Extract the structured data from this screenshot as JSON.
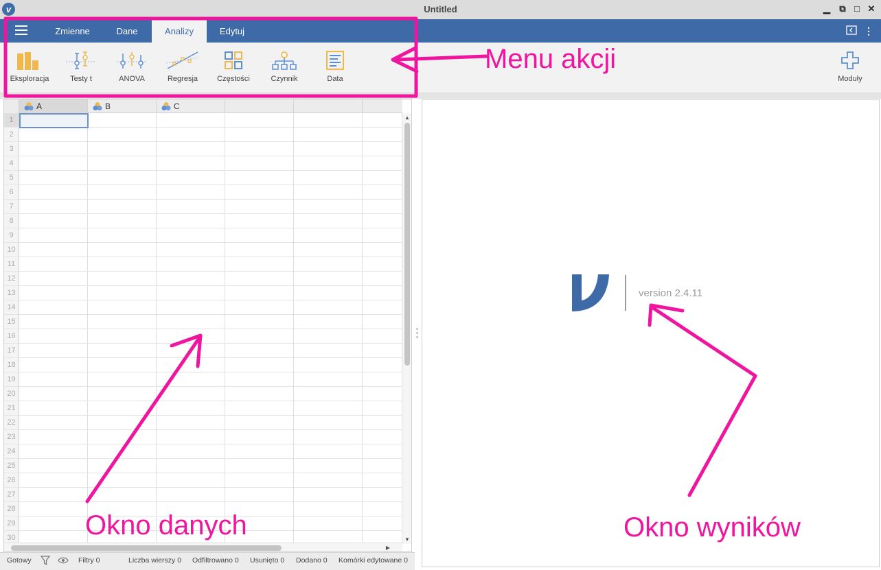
{
  "window": {
    "title": "Untitled",
    "controls": [
      "minimize-icon",
      "maximize-icon",
      "close-icon"
    ]
  },
  "tabs": [
    {
      "label": "Zmienne",
      "active": false
    },
    {
      "label": "Dane",
      "active": false
    },
    {
      "label": "Analizy",
      "active": true
    },
    {
      "label": "Edytuj",
      "active": false
    }
  ],
  "ribbon": {
    "items": [
      {
        "label": "Eksploracja",
        "icon": "exploration-bar-chart-icon"
      },
      {
        "label": "Testy t",
        "icon": "t-test-icon"
      },
      {
        "label": "ANOVA",
        "icon": "anova-icon"
      },
      {
        "label": "Regresja",
        "icon": "regression-icon"
      },
      {
        "label": "Częstości",
        "icon": "frequencies-icon"
      },
      {
        "label": "Czynnik",
        "icon": "factor-icon"
      },
      {
        "label": "Data",
        "icon": "data-table-icon"
      }
    ],
    "modules_label": "Moduły"
  },
  "spreadsheet": {
    "columns": [
      "A",
      "B",
      "C"
    ],
    "rows": [
      "1",
      "2",
      "3",
      "4",
      "5",
      "6",
      "7",
      "8",
      "9",
      "10",
      "11",
      "12",
      "13",
      "14",
      "15",
      "16",
      "17",
      "18",
      "19",
      "20",
      "21",
      "22",
      "23",
      "24",
      "25",
      "26",
      "27",
      "28",
      "29",
      "30"
    ],
    "selected_cell": "A1"
  },
  "results": {
    "version": "version 2.4.11"
  },
  "statusbar": {
    "ready": "Gotowy",
    "filters": "Filtry 0",
    "row_count": "Liczba wierszy 0",
    "filtered": "Odfiltrowano 0",
    "deleted": "Usunięto 0",
    "added": "Dodano 0",
    "edited": "Komórki edytowane 0"
  },
  "annotations": {
    "menu": "Menu akcji",
    "data_window": "Okno danych",
    "results_window": "Okno wyników",
    "color": "#f0159f"
  },
  "colors": {
    "accent_blue": "#3e6aa8",
    "ribbon_bg": "#f2f2f2",
    "icon_orange": "#f0b84a",
    "icon_blue": "#5b8fd6"
  }
}
